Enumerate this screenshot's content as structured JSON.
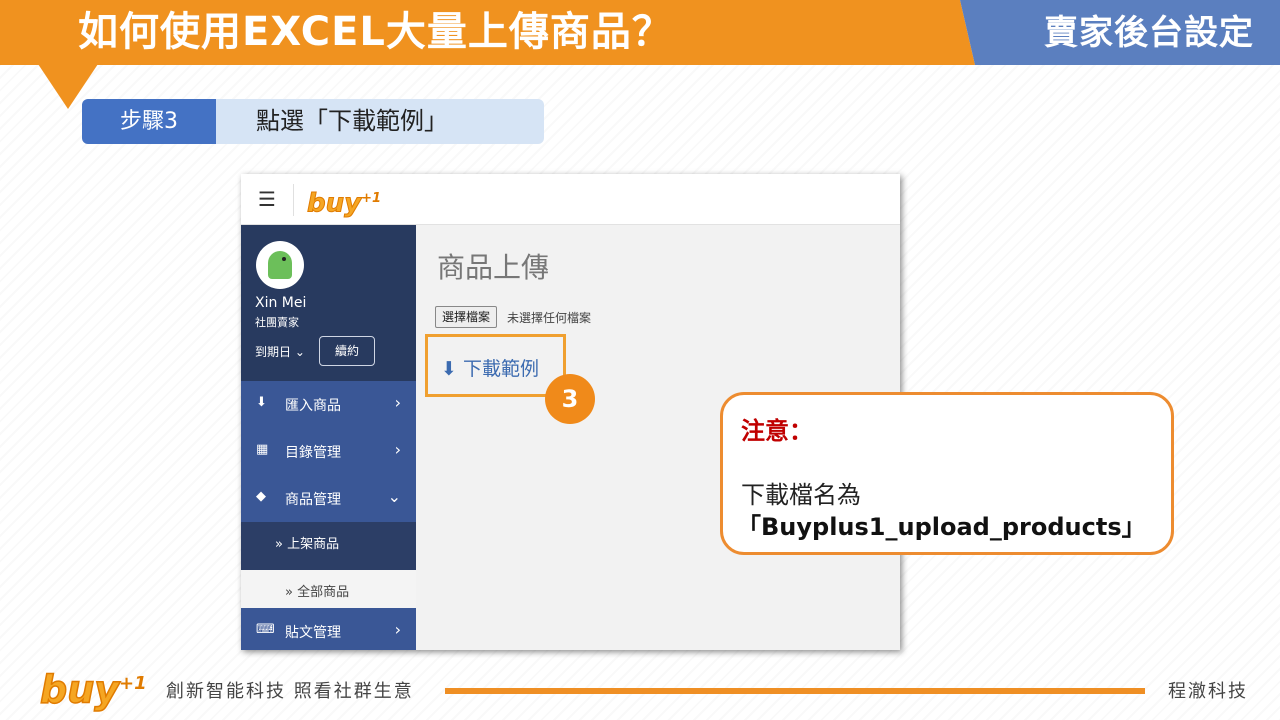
{
  "header": {
    "title": "如何使用EXCEL大量上傳商品？",
    "section": "賣家後台設定"
  },
  "step": {
    "badge": "步驟3",
    "instruction": "點選「下載範例」"
  },
  "app": {
    "topbar": {
      "menu_icon": "hamburger-icon",
      "logo_text": "buy",
      "logo_sup": "+1"
    },
    "profile": {
      "name": "Xin Mei",
      "role": "社團賣家",
      "expiry_label": "到期日",
      "renew_button": "續約"
    },
    "menu": [
      {
        "icon": "download-icon",
        "label": "匯入商品",
        "arrow": "›"
      },
      {
        "icon": "table-icon",
        "label": "目錄管理",
        "arrow": "›"
      },
      {
        "icon": "tags-icon",
        "label": "商品管理",
        "arrow": "⌄"
      },
      {
        "label": "貼文管理",
        "icon": "keyboard-icon",
        "arrow": "›"
      }
    ],
    "submenu": [
      {
        "label": "» 上架商品"
      },
      {
        "label": "» 全部商品"
      }
    ],
    "main": {
      "title": "商品上傳",
      "file_button": "選擇檔案",
      "file_status": "未選擇任何檔案",
      "download_label": "下載範例"
    }
  },
  "callout": {
    "step_number": "3"
  },
  "note": {
    "title": "注意：",
    "line1": "下載檔名為",
    "line2": "「Buyplus1_upload_products」"
  },
  "footer": {
    "logo_text": "buy",
    "logo_sup": "+1",
    "slogan": "創新智能科技 照看社群生意",
    "company": "程澈科技"
  },
  "colors": {
    "orange": "#f0921f",
    "blue": "#5b7fbf",
    "sidebar": "#2c3e66",
    "note_title": "#c00000"
  }
}
